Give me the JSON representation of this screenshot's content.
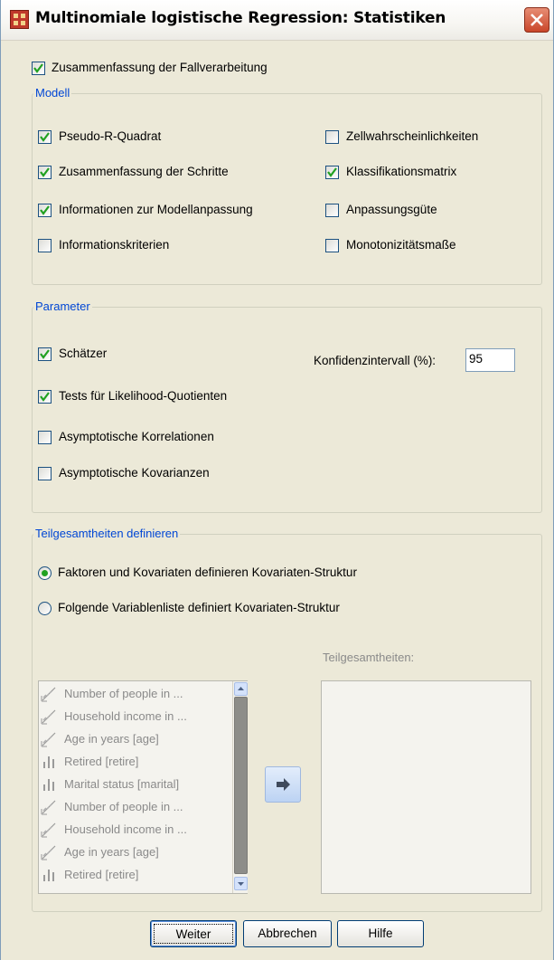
{
  "window": {
    "title": "Multinomiale logistische Regression: Statistiken"
  },
  "summary_checkbox": {
    "label": "Zusammenfassung der Fallverarbeitung",
    "checked": true
  },
  "model": {
    "title": "Modell",
    "left": [
      {
        "label": "Pseudo-R-Quadrat",
        "checked": true
      },
      {
        "label": "Zusammenfassung der Schritte",
        "checked": true
      },
      {
        "label": "Informationen zur Modellanpassung",
        "checked": true
      },
      {
        "label": "Informationskriterien",
        "checked": false
      }
    ],
    "right": [
      {
        "label": "Zellwahrscheinlichkeiten",
        "checked": false
      },
      {
        "label": "Klassifikationsmatrix",
        "checked": true
      },
      {
        "label": "Anpassungsgüte",
        "checked": false
      },
      {
        "label": "Monotonizitätsmaße",
        "checked": false
      }
    ]
  },
  "parameters": {
    "title": "Parameter",
    "items": [
      {
        "label": "Schätzer",
        "checked": true
      },
      {
        "label": "Tests für Likelihood-Quotienten",
        "checked": true
      },
      {
        "label": "Asymptotische Korrelationen",
        "checked": false
      },
      {
        "label": "Asymptotische Kovarianzen",
        "checked": false
      }
    ],
    "ci_label": "Konfidenzintervall (%):",
    "ci_value": "95"
  },
  "subpop": {
    "title": "Teilgesamtheiten definieren",
    "radio1": {
      "label": "Faktoren und Kovariaten definieren Kovariaten-Struktur",
      "selected": true
    },
    "radio2": {
      "label": "Folgende Variablenliste definiert Kovariaten-Struktur",
      "selected": false
    },
    "target_label": "Teilgesamtheiten:",
    "variables": [
      {
        "label": "Number of people in ...",
        "icon": "scale-icon"
      },
      {
        "label": "Household income in ...",
        "icon": "scale-icon"
      },
      {
        "label": "Age in years [age]",
        "icon": "scale-icon"
      },
      {
        "label": "Retired [retire]",
        "icon": "nominal-icon"
      },
      {
        "label": "Marital status [marital]",
        "icon": "nominal-icon"
      },
      {
        "label": "Number of people in ...",
        "icon": "scale-icon"
      },
      {
        "label": "Household income in ...",
        "icon": "scale-icon"
      },
      {
        "label": "Age in years [age]",
        "icon": "scale-icon"
      },
      {
        "label": "Retired [retire]",
        "icon": "nominal-icon"
      }
    ]
  },
  "buttons": {
    "continue": "Weiter",
    "cancel": "Abbrechen",
    "help": "Hilfe"
  },
  "colors": {
    "group_title": "#0046d5",
    "dialog_bg": "#ece9d8",
    "check": "#21a121"
  }
}
